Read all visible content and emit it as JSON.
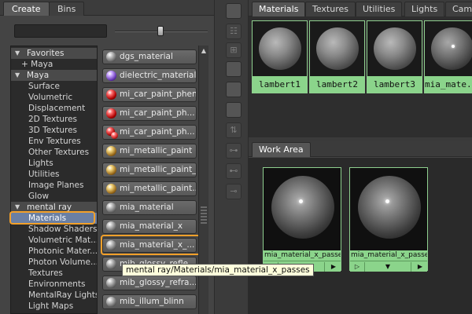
{
  "left_panel": {
    "tabs": [
      {
        "label": "Create"
      },
      {
        "label": "Bins"
      }
    ],
    "search": {
      "value": "",
      "placeholder": ""
    },
    "tree": {
      "favorites_header": "Favorites",
      "favorites_items": [
        "+ Maya"
      ],
      "maya_header": "Maya",
      "maya_items": [
        "Surface",
        "Volumetric",
        "Displacement",
        "2D Textures",
        "3D Textures",
        "Env Textures",
        "Other Textures",
        "Lights",
        "Utilities",
        "Image Planes",
        "Glow"
      ],
      "mental_ray_header": "mental ray",
      "mental_ray_items": [
        "Materials",
        "Shadow Shaders",
        "Volumetric Mat...",
        "Photonic Mater...",
        "Photon Volume...",
        "Textures",
        "Environments",
        "MentalRay Lights",
        "Light Maps"
      ],
      "selected": "Materials"
    },
    "materials": [
      {
        "label": "dgs_material",
        "icon": "grey"
      },
      {
        "label": "dielectric_material",
        "icon": "purple"
      },
      {
        "label": "mi_car_paint_phen",
        "icon": "red"
      },
      {
        "label": "mi_car_paint_ph...",
        "icon": "red"
      },
      {
        "label": "mi_car_paint_ph...",
        "icon": "red-multi"
      },
      {
        "label": "mi_metallic_paint",
        "icon": "gold"
      },
      {
        "label": "mi_metallic_paint_x",
        "icon": "gold"
      },
      {
        "label": "mi_metallic_paint...",
        "icon": "gold"
      },
      {
        "label": "mia_material",
        "icon": "grey"
      },
      {
        "label": "mia_material_x",
        "icon": "grey"
      },
      {
        "label": "mia_material_x_...",
        "icon": "grey"
      },
      {
        "label": "mib_glossy_refle...",
        "icon": "grey"
      },
      {
        "label": "mib_glossy_refra...",
        "icon": "grey"
      },
      {
        "label": "mib_illum_blinn",
        "icon": "grey"
      }
    ],
    "tooltip": "mental ray/Materials/mia_material_x_passes"
  },
  "right_panel": {
    "top_tabs": [
      {
        "label": "Materials"
      },
      {
        "label": "Textures"
      },
      {
        "label": "Utilities"
      },
      {
        "label": "Lights"
      },
      {
        "label": "Cam"
      }
    ],
    "swatches": [
      {
        "name": "lambert1"
      },
      {
        "name": "lambert2"
      },
      {
        "name": "lambert3"
      },
      {
        "name": "mia_mate..."
      }
    ],
    "bottom_tab": "Work Area",
    "work_swatches": [
      {
        "name": "mia_material_x_passes"
      },
      {
        "name": "mia_material_x_passes"
      }
    ]
  },
  "colors": {
    "highlight_orange": "#f2a02a",
    "swatch_green": "#8bd48b",
    "tree_selected": "#6a7fa3"
  }
}
